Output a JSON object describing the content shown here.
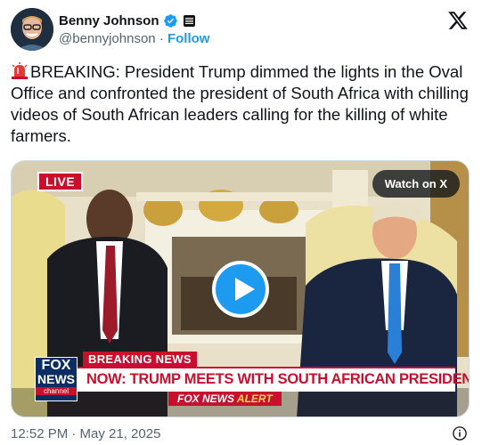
{
  "author": {
    "display_name": "Benny Johnson",
    "handle": "@bennyjohnson",
    "separator": "·",
    "follow_label": "Follow"
  },
  "tweet": {
    "emoji": "police-light-emoji",
    "text": "BREAKING: President Trump dimmed the lights in the Oval Office and confronted the president of South Africa with chilling videos of South African leaders calling for the killing of white farmers."
  },
  "media": {
    "live_label": "LIVE",
    "watch_label": "Watch on X",
    "breaking_label": "BREAKING NEWS",
    "headline": "NOW: TRUMP MEETS WITH SOUTH AFRICAN PRESIDENT",
    "fox_logo_1": "FOX",
    "fox_logo_2": "NEWS",
    "fox_logo_3": "channel",
    "alert_prefix": "FOX NEWS",
    "alert_suffix": "ALERT"
  },
  "footer": {
    "timestamp": "12:52 PM · May 21, 2025"
  },
  "colors": {
    "accent": "#1d9bf0",
    "fox_red": "#c8102e",
    "fox_blue": "#0a2e64"
  }
}
